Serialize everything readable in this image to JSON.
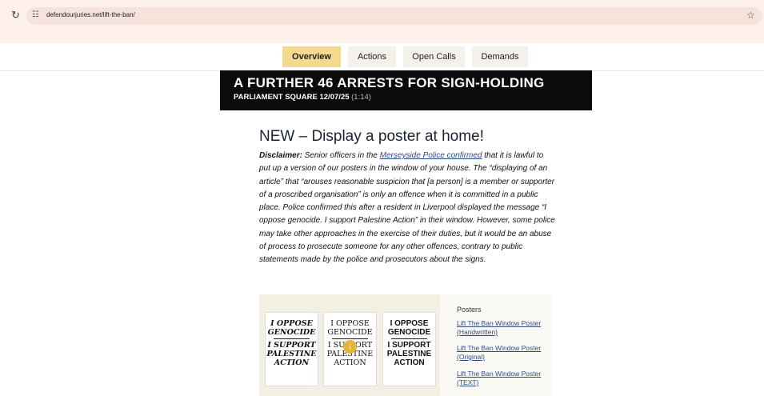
{
  "browser": {
    "url": "defendourjuries.net/lift-the-ban/"
  },
  "nav": {
    "tabs": [
      "Overview",
      "Actions",
      "Open Calls",
      "Demands"
    ]
  },
  "banner": {
    "title": "A FURTHER 46 ARRESTS FOR SIGN-HOLDING",
    "subtitle": "PARLIAMENT SQUARE 12/07/25",
    "duration": "(1:14)"
  },
  "article": {
    "heading": "NEW – Display a poster at home!",
    "disclaimer_label": "Disclaimer:",
    "text_before_link": "Senior officers in the",
    "link_text": "Merseyside Police confirmed",
    "text_after_link": "that it is lawful to put up a version of our posters in the window of your house. The “displaying of an article” that “arouses reasonable suspicion that [a person] is a member or supporter of a proscribed organisation” is only an offence when it is committed in a public place. Police confirmed this after a resident in Liverpool displayed the message “I oppose genocide. I support Palestine Action” in their window. However, some police may take other approaches in the exercise of their duties, but it would be an abuse of process to prosecute someone for any other offences, contrary to public statements made by the police and prosecutors about the signs."
  },
  "posters": {
    "images": [
      {
        "top": [
          "I OPPOSE",
          "GENOCIDE"
        ],
        "bottom": [
          "I SUPPORT",
          "PALESTINE",
          "ACTION"
        ]
      },
      {
        "top": [
          "I OPPOSE",
          "GENOCIDE"
        ],
        "bottom": [
          "I SUPPORT",
          "PALESTINE",
          "ACTION"
        ]
      },
      {
        "top": [
          "I OPPOSE",
          "GENOCIDE"
        ],
        "bottom": [
          "I SUPPORT",
          "PALESTINE",
          "ACTION"
        ]
      }
    ],
    "sidebar_title": "Posters",
    "links": [
      "Lift The Ban Window Poster (Handwritten)",
      "Lift The Ban Window Poster (Original)",
      "Lift The Ban Window Poster (TEXT)"
    ]
  },
  "colors": {
    "active_tab": "#f5d98c",
    "tab": "#f3f1ea",
    "banner": "#0b0b0b",
    "link": "#2b4b88",
    "poster_panel": "#f3efe2",
    "download_icon": "#e6b53a"
  },
  "icons": [
    "reload-icon",
    "site-settings-icon",
    "bookmark-star-icon",
    "download-icon"
  ]
}
